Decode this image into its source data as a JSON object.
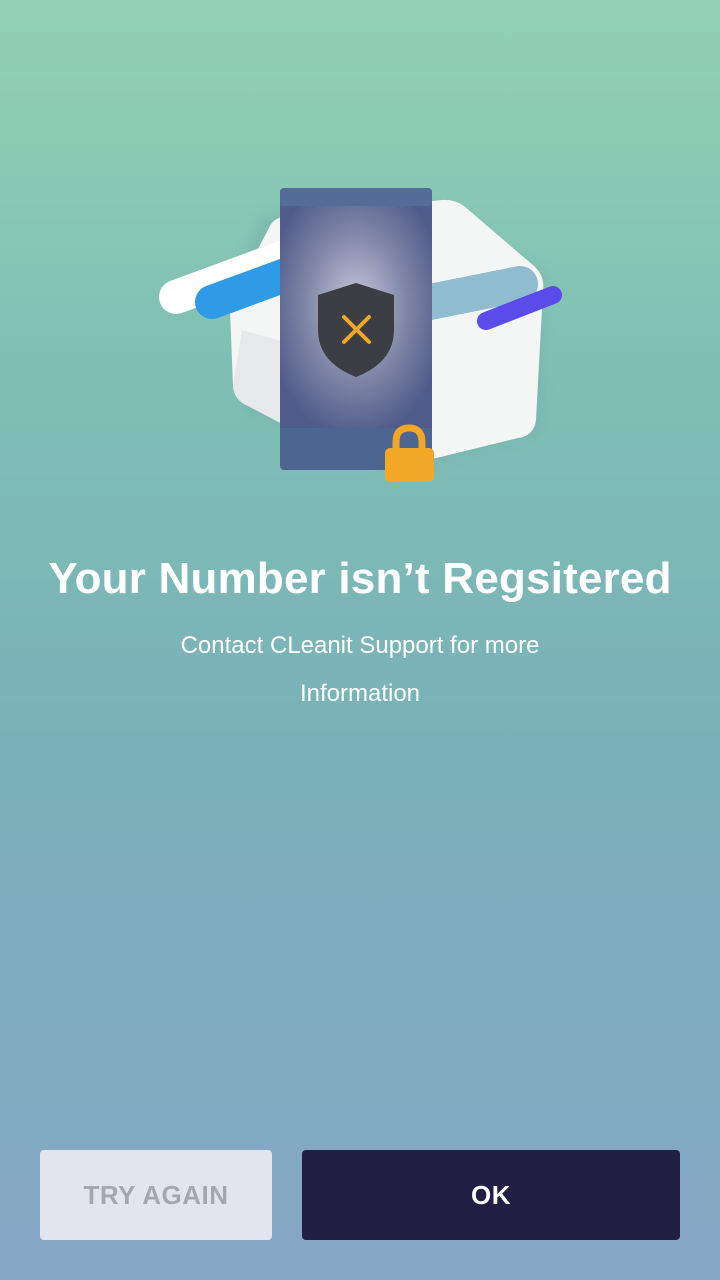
{
  "illustration": {
    "shield_icon": "shield-x-icon",
    "lock_icon": "padlock-icon",
    "colors": {
      "phone": "#4d6591",
      "shield": "#3d3d44",
      "x_mark": "#f3a726",
      "lock": "#f3a726",
      "blue_bar": "#2f9be6",
      "purple_bar": "#5a4ce8"
    }
  },
  "message": {
    "title": "Your Number isn’t Regsitered",
    "subtitle": "Contact CLeanit Support for more Information"
  },
  "actions": {
    "try_again_label": "TRY AGAIN",
    "ok_label": "OK"
  }
}
